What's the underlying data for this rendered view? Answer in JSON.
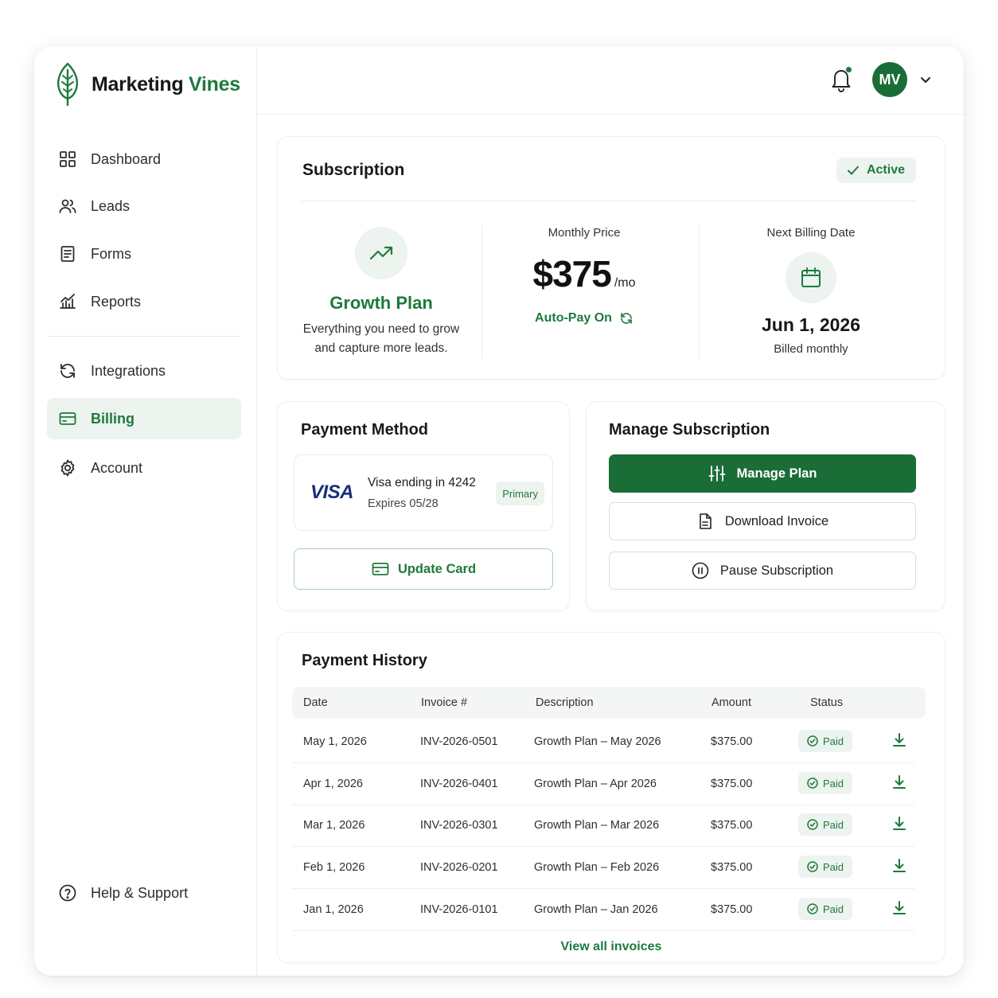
{
  "brand": {
    "name_part1": "Marketing",
    "name_part2": "Vines"
  },
  "sidebar": {
    "items": [
      {
        "label": "Dashboard",
        "icon": "grid-icon"
      },
      {
        "label": "Leads",
        "icon": "users-icon"
      },
      {
        "label": "Forms",
        "icon": "document-icon"
      },
      {
        "label": "Reports",
        "icon": "chart-icon"
      },
      {
        "label": "Integrations",
        "icon": "sync-icon"
      },
      {
        "label": "Billing",
        "icon": "credit-card-icon",
        "active": true
      },
      {
        "label": "Account",
        "icon": "gear-icon"
      }
    ],
    "help_label": "Help & Support"
  },
  "header": {
    "avatar_initials": "MV",
    "notification_dot": true
  },
  "subscription": {
    "title": "Subscription",
    "status": "Active",
    "plan_name": "Growth Plan",
    "plan_desc_line1": "Everything you need to grow",
    "plan_desc_line2": "and capture more leads.",
    "price_label": "Monthly Price",
    "price": "$375",
    "price_unit": "/mo",
    "autopay": "Auto-Pay On",
    "next_label": "Next Billing Date",
    "next_date": "Jun 1, 2026",
    "billing_cycle": "Billed monthly"
  },
  "payment_method": {
    "title": "Payment Method",
    "card_brand": "VISA",
    "card_line": "Visa ending in 4242",
    "expiry": "Expires 05/28",
    "badge": "Primary",
    "update_label": "Update Card"
  },
  "manage": {
    "title": "Manage Subscription",
    "manage_plan": "Manage Plan",
    "download_invoice": "Download Invoice",
    "pause": "Pause Subscription"
  },
  "history": {
    "title": "Payment History",
    "columns": [
      "Date",
      "Invoice #",
      "Description",
      "Amount",
      "Status"
    ],
    "rows": [
      {
        "date": "May 1, 2026",
        "invoice": "INV-2026-0501",
        "description": "Growth Plan – May 2026",
        "amount": "$375.00",
        "status": "Paid"
      },
      {
        "date": "Apr 1, 2026",
        "invoice": "INV-2026-0401",
        "description": "Growth Plan – Apr 2026",
        "amount": "$375.00",
        "status": "Paid"
      },
      {
        "date": "Mar 1, 2026",
        "invoice": "INV-2026-0301",
        "description": "Growth Plan – Mar 2026",
        "amount": "$375.00",
        "status": "Paid"
      },
      {
        "date": "Feb 1, 2026",
        "invoice": "INV-2026-0201",
        "description": "Growth Plan – Feb 2026",
        "amount": "$375.00",
        "status": "Paid"
      },
      {
        "date": "Jan 1, 2026",
        "invoice": "INV-2026-0101",
        "description": "Growth Plan – Jan 2026",
        "amount": "$375.00",
        "status": "Paid"
      }
    ],
    "view_all": "View all invoices"
  },
  "colors": {
    "accent": "#1e7a3c",
    "accent_dark": "#1a6d37",
    "accent_light": "#edf3ef"
  }
}
